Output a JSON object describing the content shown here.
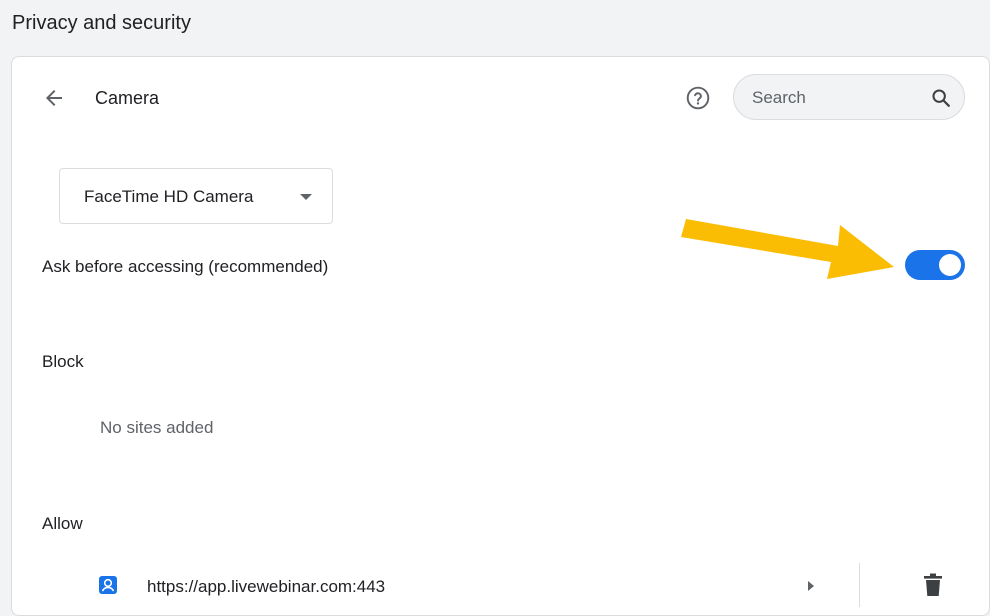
{
  "section": {
    "title": "Privacy and security"
  },
  "header": {
    "title": "Camera",
    "back_icon": "arrow-left-icon",
    "help_icon": "help-circle-icon",
    "search": {
      "placeholder": "Search",
      "value": "",
      "icon": "search-icon"
    }
  },
  "camera_select": {
    "selected": "FaceTime HD Camera",
    "icon": "caret-down-icon"
  },
  "ask_setting": {
    "label": "Ask before accessing (recommended)",
    "enabled": true
  },
  "block": {
    "heading": "Block",
    "empty_text": "No sites added"
  },
  "allow": {
    "heading": "Allow",
    "sites": [
      {
        "url": "https://app.livewebinar.com:443",
        "favicon": "site-favicon-icon"
      }
    ]
  },
  "annotation": {
    "arrow_color": "#fbbc04"
  },
  "colors": {
    "accent": "#1a73e8",
    "text": "#202124",
    "secondary_text": "#5f6368",
    "border": "#dadce0"
  }
}
